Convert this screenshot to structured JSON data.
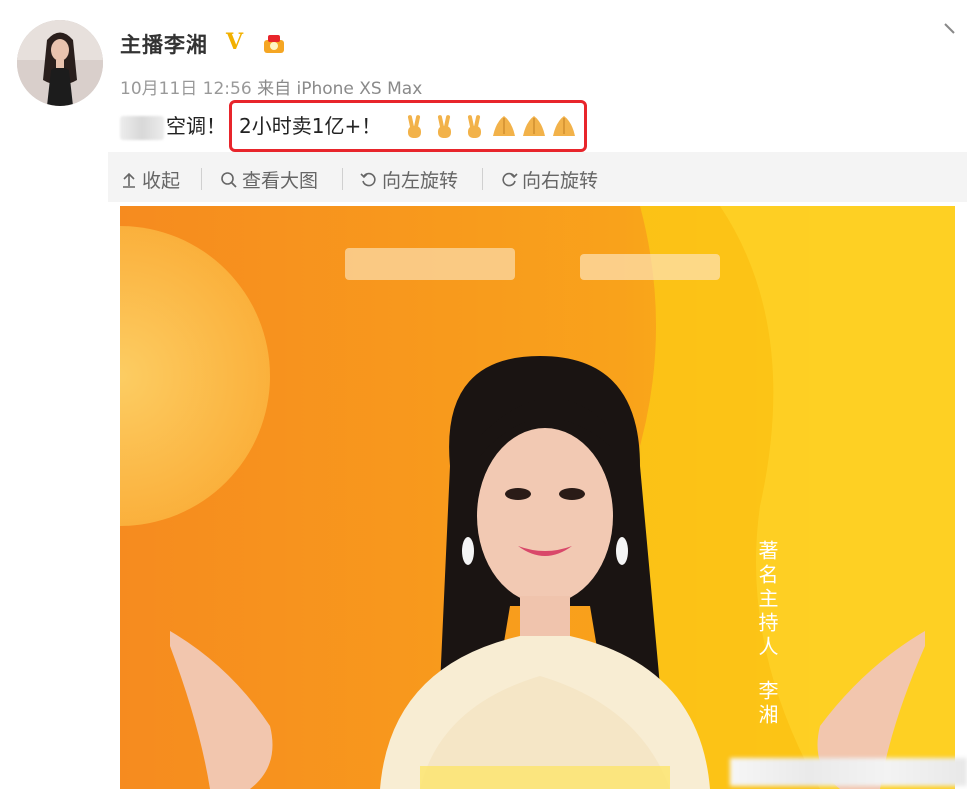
{
  "user": {
    "name": "主播李湘",
    "verified_badge": "V"
  },
  "post": {
    "date": "10月11日 12:56",
    "source": "来自 iPhone XS Max",
    "text_prefix": "空调！",
    "highlighted_text": "2小时卖1亿+！",
    "emojis": [
      "victory-hand",
      "victory-hand",
      "victory-hand",
      "clap-hands",
      "clap-hands",
      "clap-hands"
    ]
  },
  "toolbar": {
    "collapse_label": "收起",
    "view_large_label": "查看大图",
    "rotate_left_label": "向左旋转",
    "rotate_right_label": "向右旋转"
  },
  "image": {
    "caption_title": "著名主持人",
    "caption_name": "李湘"
  },
  "colors": {
    "highlight_border": "#e8252b",
    "verified": "#f2b000",
    "photo_orange": "#f7941d",
    "photo_yellow": "#fdc300"
  }
}
